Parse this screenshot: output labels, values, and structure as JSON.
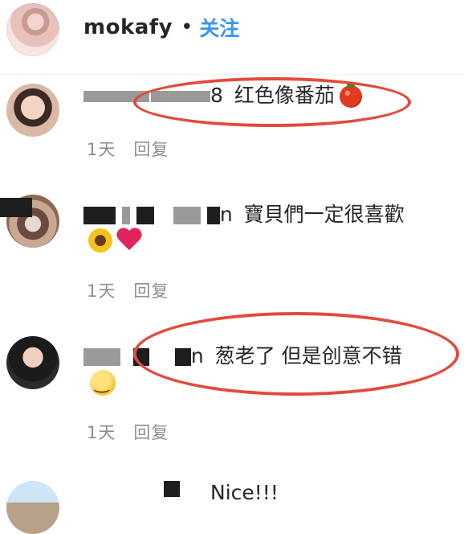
{
  "header": {
    "username": "mokafy",
    "separator": "•",
    "follow_label": "关注"
  },
  "comments": [
    {
      "username_visible": "8",
      "text": "红色像番茄",
      "emoji": "tomato-emoji",
      "time": "1天",
      "reply_label": "回复"
    },
    {
      "username_visible": "n",
      "text": "寶貝們一定很喜歡",
      "emoji": [
        "sunflower-emoji",
        "red-heart-emoji"
      ],
      "time": "1天",
      "reply_label": "回复"
    },
    {
      "username_visible": "n",
      "text": "葱老了 但是创意不错",
      "emoji": "smiling-face-emoji",
      "time": "1天",
      "reply_label": "回复"
    },
    {
      "username_visible": "",
      "text": "Nice!!!"
    }
  ],
  "colors": {
    "follow": "#3897f0",
    "meta": "#8e8e8e",
    "highlight": "#e34a3b"
  }
}
